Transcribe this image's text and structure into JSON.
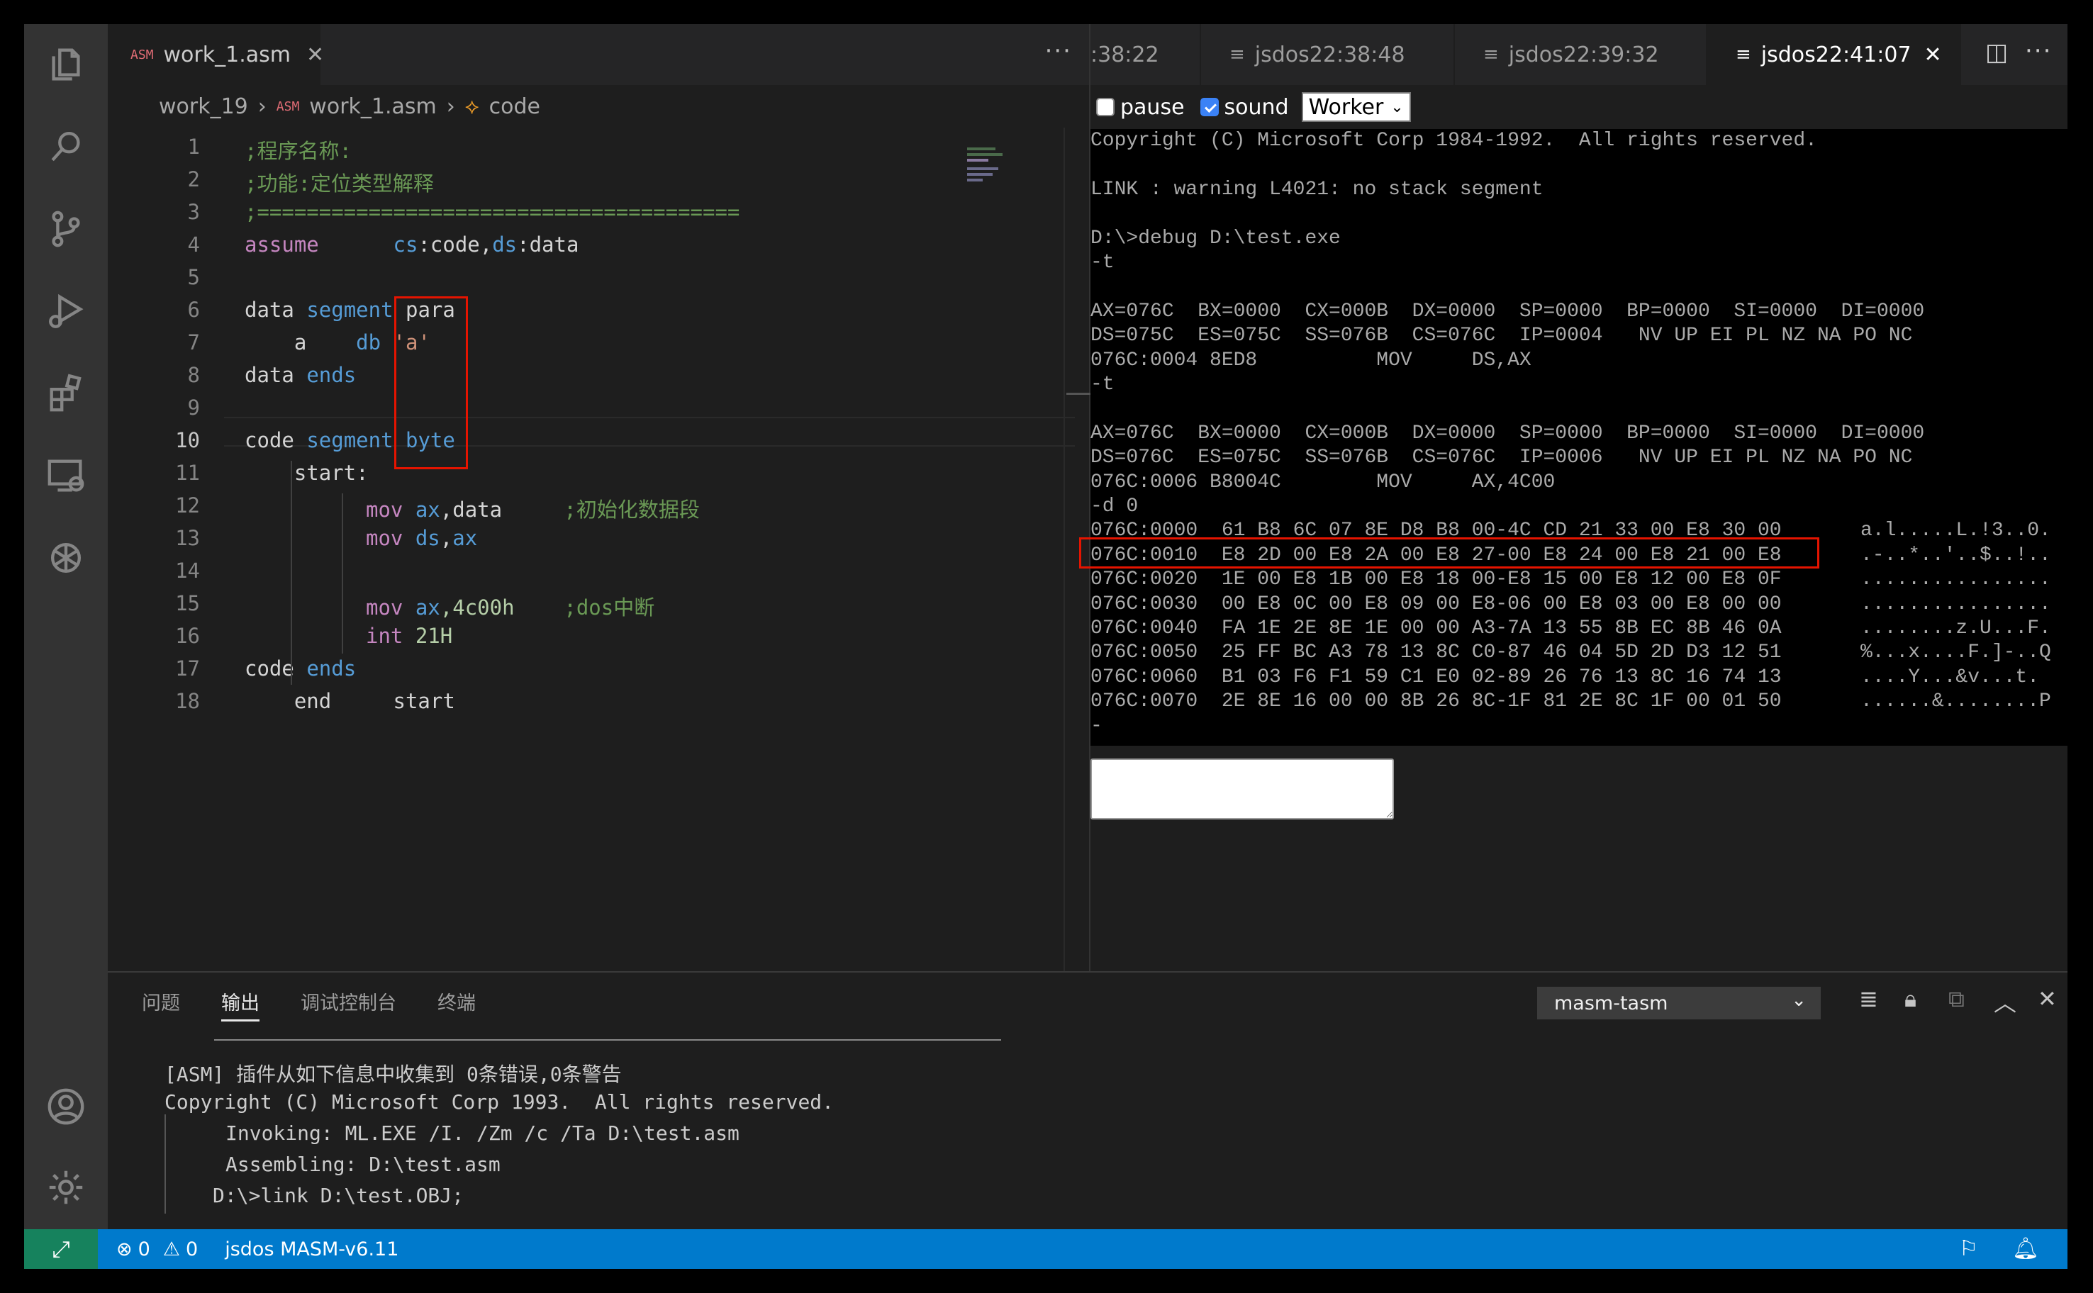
{
  "editor": {
    "tab_label": "work_1.asm",
    "tab_badge": "ASM",
    "more": "···",
    "breadcrumb": [
      "work_19",
      "work_1.asm",
      "code"
    ],
    "breadcrumb_sep": "›",
    "line_numbers": [
      "1",
      "2",
      "3",
      "4",
      "5",
      "6",
      "7",
      "8",
      "9",
      "10",
      "11",
      "12",
      "13",
      "14",
      "15",
      "16",
      "17",
      "18"
    ],
    "lines": {
      "l1": ";程序名称:",
      "l2": ";功能:定位类型解释",
      "l3": ";=======================================",
      "l4_kw": "assume",
      "l4_r1": "cs",
      "l4_t1": ":code,",
      "l4_r2": "ds",
      "l4_t2": ":data",
      "l6_a": "data ",
      "l6_b": "segment",
      "l6_c": " para",
      "l7_a": "    a    ",
      "l7_b": "db",
      "l7_c": " 'a'",
      "l8_a": "data ",
      "l8_b": "ends",
      "l10_a": "code ",
      "l10_b": "segment",
      "l10_c": " byte",
      "l11": "    start:",
      "l12_ins": "mov",
      "l12_r": " ax",
      "l12_t": ",data",
      "l12_c": ";初始化数据段",
      "l13_ins": "mov",
      "l13_r1": " ds",
      "l13_t": ",",
      "l13_r2": "ax",
      "l15_ins": "mov",
      "l15_r": " ax",
      "l15_n": ",4c00h",
      "l15_c": ";dos中断",
      "l16_ins": "int",
      "l16_n": " 21H",
      "l17_a": "code ",
      "l17_b": "ends",
      "l18_a": "    end     start"
    }
  },
  "right_panel": {
    "tabs": [
      ":38:22",
      "jsdos22:38:48",
      "jsdos22:39:32",
      "jsdos22:41:07"
    ],
    "pause_label": "pause",
    "sound_label": "sound",
    "worker_select": "Worker",
    "dos_lines": [
      "Copyright (C) Microsoft Corp 1984-1992.  All rights reserved.",
      "",
      "LINK : warning L4021: no stack segment",
      "",
      "D:\\>debug D:\\test.exe",
      "-t",
      "",
      "AX=076C  BX=0000  CX=000B  DX=0000  SP=0000  BP=0000  SI=0000  DI=0000",
      "DS=075C  ES=075C  SS=076B  CS=076C  IP=0004   NV UP EI PL NZ NA PO NC",
      "076C:0004 8ED8          MOV     DS,AX",
      "-t",
      "",
      "AX=076C  BX=0000  CX=000B  DX=0000  SP=0000  BP=0000  SI=0000  DI=0000",
      "DS=076C  ES=075C  SS=076B  CS=076C  IP=0006   NV UP EI PL NZ NA PO NC",
      "076C:0006 B8004C        MOV     AX,4C00",
      "-d 0",
      "076C:0000  61 B8 6C 07 8E D8 B8 00-4C CD 21 33 00 E8 30 00",
      "076C:0010  E8 2D 00 E8 2A 00 E8 27-00 E8 24 00 E8 21 00 E8",
      "076C:0020  1E 00 E8 1B 00 E8 18 00-E8 15 00 E8 12 00 E8 0F",
      "076C:0030  00 E8 0C 00 E8 09 00 E8-06 00 E8 03 00 E8 00 00",
      "076C:0040  FA 1E 2E 8E 1E 00 00 A3-7A 13 55 8B EC 8B 46 0A",
      "076C:0050  25 FF BC A3 78 13 8C C0-87 46 04 5D 2D D3 12 51",
      "076C:0060  B1 03 F6 F1 59 C1 E0 02-89 26 76 13 8C 16 74 13",
      "076C:0070  2E 8E 16 00 00 8B 26 8C-1F 81 2E 8C 1F 00 01 50",
      "-"
    ],
    "dos_ascii": [
      "a.l.....L.!3..0.",
      ".-..*..'..$..!..",
      "................",
      "................",
      "........z.U...F.",
      "%...x....F.]-..Q",
      "....Y...&v...t.",
      "......&........P"
    ]
  },
  "panel": {
    "tabs": [
      "问题",
      "输出",
      "调试控制台",
      "终端"
    ],
    "active_tab": "输出",
    "select": "masm-tasm",
    "output": [
      "[ASM] 插件从如下信息中收集到 0条错误,0条警告",
      "Copyright (C) Microsoft Corp 1993.  All rights reserved.",
      "Invoking: ML.EXE /I. /Zm /c /Ta D:\\test.asm",
      "Assembling: D:\\test.asm",
      "D:\\>link D:\\test.OBJ;"
    ]
  },
  "status": {
    "errors": "0",
    "warnings": "0",
    "env": "jsdos MASM-v6.11"
  }
}
